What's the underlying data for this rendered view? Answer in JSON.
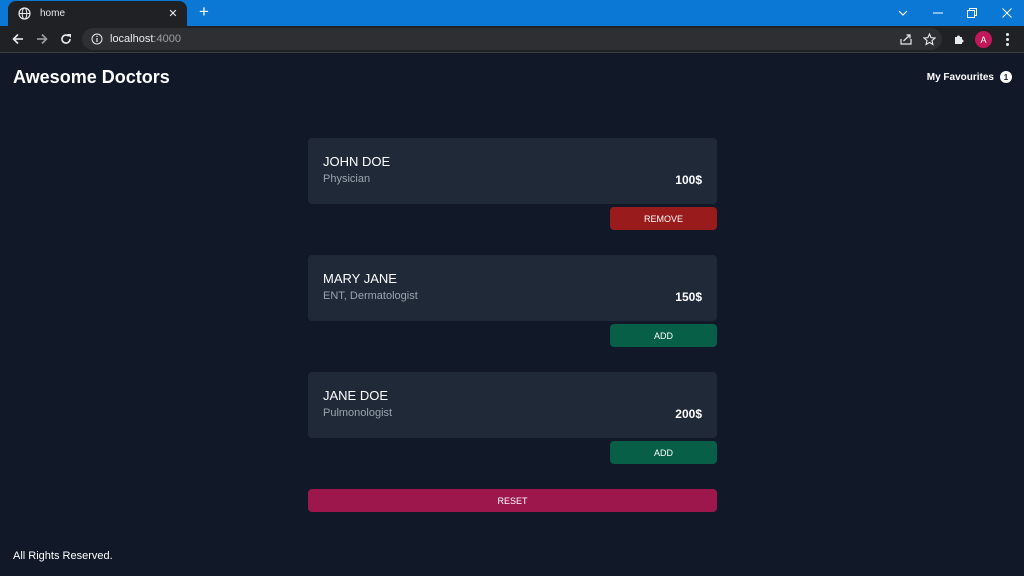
{
  "browser": {
    "tab_title": "home",
    "tab_close": "✕",
    "new_tab": "+",
    "url_host": "localhost",
    "url_port": ":4000",
    "profile_initial": "A"
  },
  "app": {
    "title": "Awesome Doctors",
    "favourites_label": "My Favourites",
    "favourites_count": "1"
  },
  "doctors": [
    {
      "name": "JOHN DOE",
      "specialty": "Physician",
      "price": "100$",
      "action": "REMOVE"
    },
    {
      "name": "MARY JANE",
      "specialty": "ENT, Dermatologist",
      "price": "150$",
      "action": "ADD"
    },
    {
      "name": "JANE DOE",
      "specialty": "Pulmonologist",
      "price": "200$",
      "action": "ADD"
    }
  ],
  "reset_label": "RESET",
  "footer": "All Rights Reserved.",
  "colors": {
    "background": "#111827",
    "card": "#1f2937",
    "remove": "#991b1b",
    "add": "#065f46",
    "reset": "#9d174d",
    "browser_accent": "#0a78d4"
  }
}
